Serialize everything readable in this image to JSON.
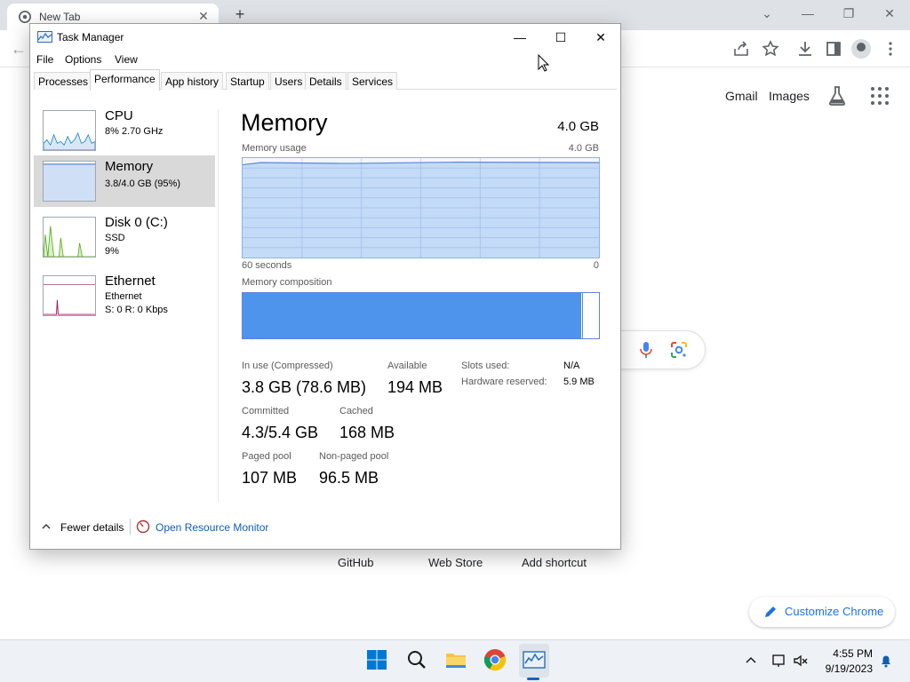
{
  "browser": {
    "tab_title": "New Tab",
    "toolbar_links": {
      "gmail": "Gmail",
      "images": "Images"
    },
    "shortcuts": [
      "GitHub",
      "Web Store",
      "Add shortcut"
    ],
    "customize_label": "Customize Chrome",
    "accent_color": "#1a73e8"
  },
  "task_manager": {
    "title": "Task Manager",
    "menus": [
      "File",
      "Options",
      "View"
    ],
    "tabs": [
      "Processes",
      "Performance",
      "App history",
      "Startup",
      "Users",
      "Details",
      "Services"
    ],
    "active_tab": "Performance",
    "sidebar": [
      {
        "name": "CPU",
        "lines": [
          "8%  2.70 GHz"
        ]
      },
      {
        "name": "Memory",
        "lines": [
          "3.8/4.0 GB (95%)"
        ]
      },
      {
        "name": "Disk 0 (C:)",
        "lines": [
          "SSD",
          "9%"
        ]
      },
      {
        "name": "Ethernet",
        "lines": [
          "Ethernet",
          "S: 0  R: 0 Kbps"
        ]
      }
    ],
    "selected_item": "Memory",
    "memory": {
      "heading": "Memory",
      "total": "4.0 GB",
      "usage_label": "Memory usage",
      "usage_max": "4.0 GB",
      "time_left": "60 seconds",
      "time_right": "0",
      "composition_label": "Memory composition",
      "usage_level": 0.95,
      "composition_in_use_fraction": 0.95,
      "stats": {
        "in_use_label": "In use (Compressed)",
        "in_use_value": "3.8 GB (78.6 MB)",
        "available_label": "Available",
        "available_value": "194 MB",
        "committed_label": "Committed",
        "committed_value": "4.3/5.4 GB",
        "cached_label": "Cached",
        "cached_value": "168 MB",
        "paged_label": "Paged pool",
        "paged_value": "107 MB",
        "nonpaged_label": "Non-paged pool",
        "nonpaged_value": "96.5 MB",
        "slots_label": "Slots used:",
        "slots_value": "N/A",
        "reserved_label": "Hardware reserved:",
        "reserved_value": "5.9 MB"
      }
    },
    "footer": {
      "fewer_details": "Fewer details",
      "resource_monitor": "Open Resource Monitor"
    },
    "colors": {
      "memory_fill": "#4e93ec",
      "memory_line": "#5c86d4",
      "cpu_line": "#117dbb",
      "disk_line": "#4da60c",
      "ethernet_line": "#a7175d"
    }
  },
  "taskbar": {
    "apps": [
      "windows-start-icon",
      "search-icon",
      "file-explorer-icon",
      "chrome-icon",
      "task-manager-icon"
    ],
    "time": "4:55 PM",
    "date": "9/19/2023"
  }
}
